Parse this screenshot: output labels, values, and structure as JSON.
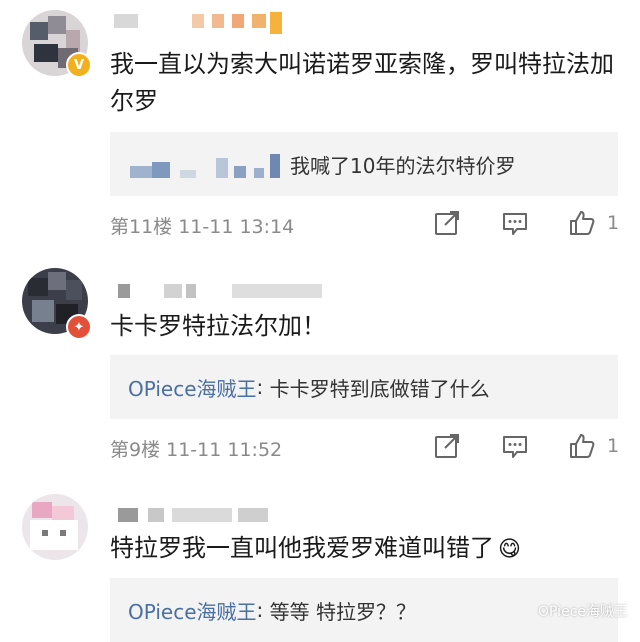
{
  "colors": {
    "link": "#4a6fa3",
    "meta": "#8a8a8a",
    "reply_bg": "#f3f3f3",
    "badge_gold": "#f2b01e",
    "badge_red": "#e2503a"
  },
  "comments": [
    {
      "text": "我一直以为索大叫诺诺罗亚索隆，罗叫特拉法加尔罗",
      "badge": "V",
      "reply": {
        "name": "",
        "text": "我喊了10年的法尔特价罗"
      },
      "floor_time": "第11楼 11-11 13:14",
      "likes": "1",
      "icons": [
        "share-icon",
        "reply-icon",
        "thumbs-up-icon"
      ]
    },
    {
      "text": "卡卡罗特拉法尔加！",
      "badge": "✦",
      "reply": {
        "name": "OPiece海贼王",
        "sep": ": ",
        "text": "卡卡罗特到底做错了什么"
      },
      "floor_time": "第9楼 11-11 11:52",
      "likes": "1",
      "icons": [
        "share-icon",
        "reply-icon",
        "thumbs-up-icon"
      ]
    },
    {
      "text": "特拉罗我一直叫他我爱罗难道叫错了",
      "emoji": "😋",
      "reply": {
        "name": "OPiece海贼王",
        "sep": ": ",
        "text": "等等 特拉罗？？"
      }
    }
  ],
  "watermark": "OPiece海贼王"
}
